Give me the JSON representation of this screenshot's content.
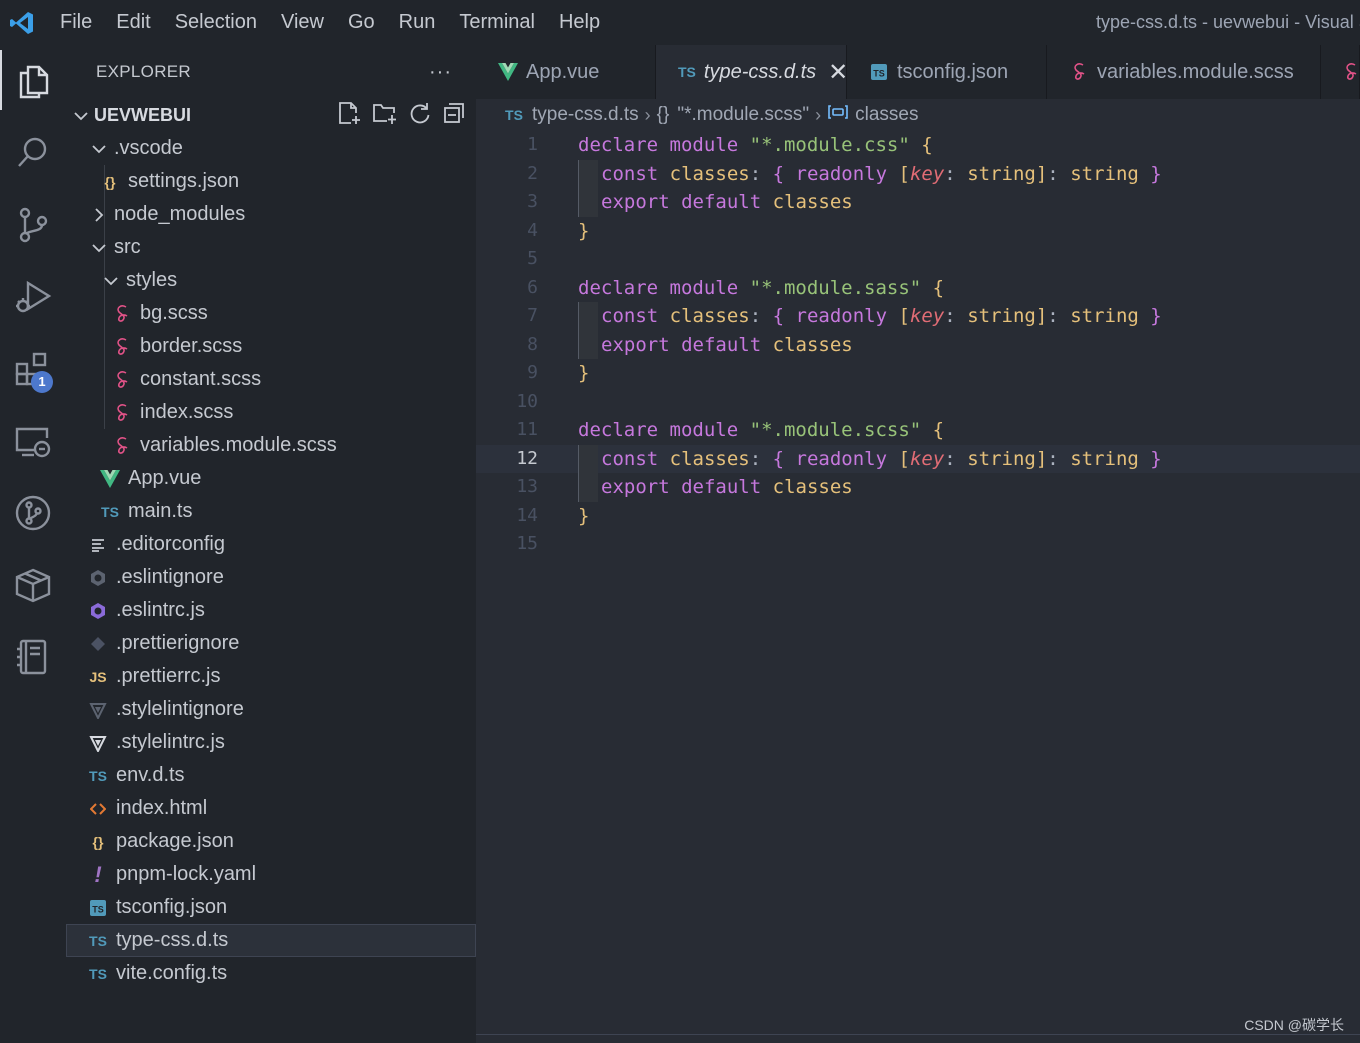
{
  "titlebar": {
    "menu": [
      "File",
      "Edit",
      "Selection",
      "View",
      "Go",
      "Run",
      "Terminal",
      "Help"
    ],
    "window_title": "type-css.d.ts - uevwebui - Visual S"
  },
  "activity": {
    "extensions_badge": "1"
  },
  "sidebar": {
    "title": "EXPLORER",
    "more": "···",
    "project": "UEVWEBUI"
  },
  "tree": [
    {
      "name": ".vscode",
      "icon": "chevron-down"
    },
    {
      "name": "settings.json",
      "icon": "json-icon"
    },
    {
      "name": "node_modules",
      "icon": "chevron-right"
    },
    {
      "name": "src",
      "icon": "chevron-down"
    },
    {
      "name": "styles",
      "icon": "chevron-down"
    },
    {
      "name": "bg.scss",
      "icon": "sass-icon"
    },
    {
      "name": "border.scss",
      "icon": "sass-icon"
    },
    {
      "name": "constant.scss",
      "icon": "sass-icon"
    },
    {
      "name": "index.scss",
      "icon": "sass-icon"
    },
    {
      "name": "variables.module.scss",
      "icon": "sass-icon"
    },
    {
      "name": "App.vue",
      "icon": "vue-icon"
    },
    {
      "name": "main.ts",
      "icon": "ts-icon"
    },
    {
      "name": ".editorconfig",
      "icon": "lines-icon"
    },
    {
      "name": ".eslintignore",
      "icon": "eslint-icon"
    },
    {
      "name": ".eslintrc.js",
      "icon": "eslint-icon"
    },
    {
      "name": ".prettierignore",
      "icon": "prettier-icon"
    },
    {
      "name": ".prettierrc.js",
      "icon": "js-icon"
    },
    {
      "name": ".stylelintignore",
      "icon": "stylelint-icon"
    },
    {
      "name": ".stylelintrc.js",
      "icon": "stylelint-icon"
    },
    {
      "name": "env.d.ts",
      "icon": "ts-icon"
    },
    {
      "name": "index.html",
      "icon": "html-icon"
    },
    {
      "name": "package.json",
      "icon": "json-icon"
    },
    {
      "name": "pnpm-lock.yaml",
      "icon": "yaml-icon"
    },
    {
      "name": "tsconfig.json",
      "icon": "tsconfig-icon"
    },
    {
      "name": "type-css.d.ts",
      "icon": "ts-icon"
    },
    {
      "name": "vite.config.ts",
      "icon": "ts-icon"
    }
  ],
  "tabs": [
    {
      "label": "App.vue"
    },
    {
      "label": "type-css.d.ts",
      "close": "✕"
    },
    {
      "label": "tsconfig.json"
    },
    {
      "label": "variables.module.scss"
    }
  ],
  "breadcrumb": {
    "file": "type-css.d.ts",
    "module": "\"*.module.scss\"",
    "symbol": "classes",
    "module_glyph": "{}"
  },
  "code": {
    "line_numbers": [
      "1",
      "2",
      "3",
      "4",
      "5",
      "6",
      "7",
      "8",
      "9",
      "10",
      "11",
      "12",
      "13",
      "14",
      "15"
    ],
    "modules": [
      "\"*.module.css\"",
      "\"*.module.sass\"",
      "\"*.module.scss\""
    ],
    "kw_declare": "declare",
    "kw_module": "module",
    "kw_const": "const",
    "kw_readonly": "readonly",
    "kw_export": "export",
    "kw_default": "default",
    "ident_classes": "classes",
    "ident_key": "key",
    "type_string": "string"
  },
  "watermark": "CSDN @碳学长"
}
